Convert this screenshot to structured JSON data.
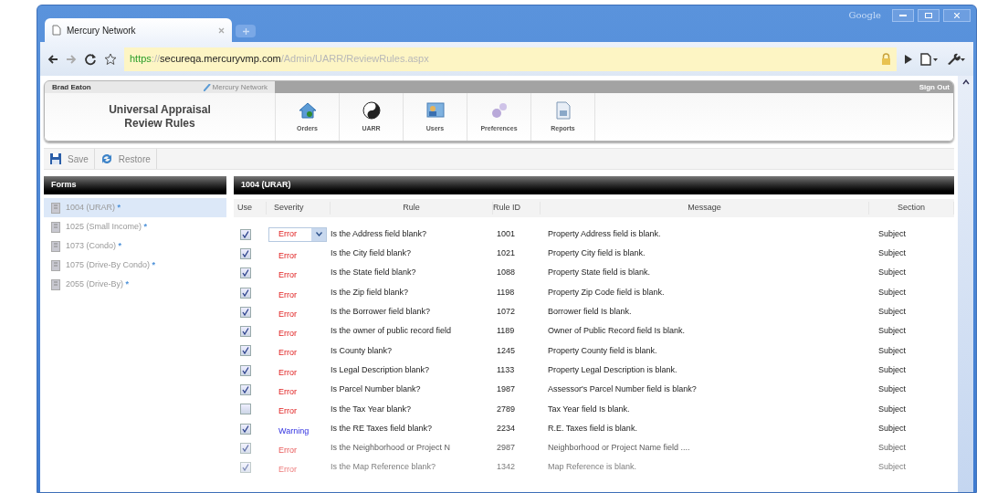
{
  "browser": {
    "tab_title": "Mercury Network",
    "brand": "Google",
    "url_parts": [
      {
        "kind": "scheme",
        "text": "https"
      },
      {
        "kind": "faint",
        "text": "://"
      },
      {
        "kind": "host",
        "text": "secureqa.mercuryvmp.com"
      },
      {
        "kind": "faint",
        "text": "/Admin/UARR/ReviewRules.aspx"
      }
    ]
  },
  "header": {
    "user": "Brad Eaton",
    "brand": "Mercury Network",
    "sign_out": "Sign Out",
    "title": "Universal Appraisal Review Rules",
    "nav": [
      {
        "kind": "orders",
        "label": "Orders"
      },
      {
        "kind": "uarr",
        "label": "UARR"
      },
      {
        "kind": "users",
        "label": "Users"
      },
      {
        "kind": "preferences",
        "label": "Preferences"
      },
      {
        "kind": "reports",
        "label": "Reports"
      }
    ]
  },
  "toolbar": [
    {
      "kind": "save",
      "label": "Save"
    },
    {
      "kind": "restore",
      "label": "Restore"
    }
  ],
  "forms": {
    "title": "Forms",
    "items": [
      {
        "label": "1004 (URAR)",
        "mark": "*",
        "selected": true
      },
      {
        "label": "1025 (Small Income)",
        "mark": "*",
        "selected": false
      },
      {
        "label": "1073 (Condo)",
        "mark": "*",
        "selected": false
      },
      {
        "label": "1075 (Drive-By Condo)",
        "mark": "*",
        "selected": false
      },
      {
        "label": "2055 (Drive-By)",
        "mark": "*",
        "selected": false
      }
    ]
  },
  "table": {
    "title": "1004 (URAR)",
    "columns": [
      "Use",
      "Severity",
      "Rule",
      "Rule ID",
      "Message",
      "Section"
    ],
    "rows": [
      {
        "use": true,
        "severity": "Error",
        "kind": "error",
        "dropdown": true,
        "rule": "Is the Address field blank?",
        "rule_id": "1001",
        "message": "Property Address field is blank.",
        "section": "Subject"
      },
      {
        "use": true,
        "severity": "Error",
        "kind": "error",
        "dropdown": false,
        "rule": "Is the City field blank?",
        "rule_id": "1021",
        "message": "Property City field is blank.",
        "section": "Subject"
      },
      {
        "use": true,
        "severity": "Error",
        "kind": "error",
        "dropdown": false,
        "rule": "Is the State field blank?",
        "rule_id": "1088",
        "message": "Property State field is blank.",
        "section": "Subject"
      },
      {
        "use": true,
        "severity": "Error",
        "kind": "error",
        "dropdown": false,
        "rule": "Is the Zip field blank?",
        "rule_id": "1198",
        "message": "Property Zip Code field is blank.",
        "section": "Subject"
      },
      {
        "use": true,
        "severity": "Error",
        "kind": "error",
        "dropdown": false,
        "rule": "Is the Borrower field blank?",
        "rule_id": "1072",
        "message": "Borrower field Is blank.",
        "section": "Subject"
      },
      {
        "use": true,
        "severity": "Error",
        "kind": "error",
        "dropdown": false,
        "rule": "Is the owner of public record field",
        "rule_id": "1189",
        "message": "Owner of Public Record field Is blank.",
        "section": "Subject"
      },
      {
        "use": true,
        "severity": "Error",
        "kind": "error",
        "dropdown": false,
        "rule": "Is County blank?",
        "rule_id": "1245",
        "message": "Property County field is blank.",
        "section": "Subject"
      },
      {
        "use": true,
        "severity": "Error",
        "kind": "error",
        "dropdown": false,
        "rule": "Is Legal Description blank?",
        "rule_id": "1133",
        "message": "Property Legal Description is blank.",
        "section": "Subject"
      },
      {
        "use": true,
        "severity": "Error",
        "kind": "error",
        "dropdown": false,
        "rule": "Is Parcel Number blank?",
        "rule_id": "1987",
        "message": "Assessor's Parcel Number field is blank?",
        "section": "Subject"
      },
      {
        "use": false,
        "severity": "Error",
        "kind": "error",
        "dropdown": false,
        "rule": "Is the Tax Year blank?",
        "rule_id": "2789",
        "message": "Tax Year field Is blank.",
        "section": "Subject"
      },
      {
        "use": true,
        "severity": "Warning",
        "kind": "warning",
        "dropdown": false,
        "rule": "Is the RE Taxes field blank?",
        "rule_id": "2234",
        "message": "R.E. Taxes field is blank.",
        "section": "Subject"
      },
      {
        "use": true,
        "severity": "Error",
        "kind": "error",
        "dropdown": false,
        "rule": "Is the Neighborhood or Project N",
        "rule_id": "2987",
        "message": "Neighborhood or Project Name field ....",
        "section": "Subject"
      },
      {
        "use": true,
        "severity": "Error",
        "kind": "error",
        "dropdown": false,
        "rule": "Is the Map Reference blank?",
        "rule_id": "1342",
        "message": "Map Reference is blank.",
        "section": "Subject"
      }
    ]
  }
}
